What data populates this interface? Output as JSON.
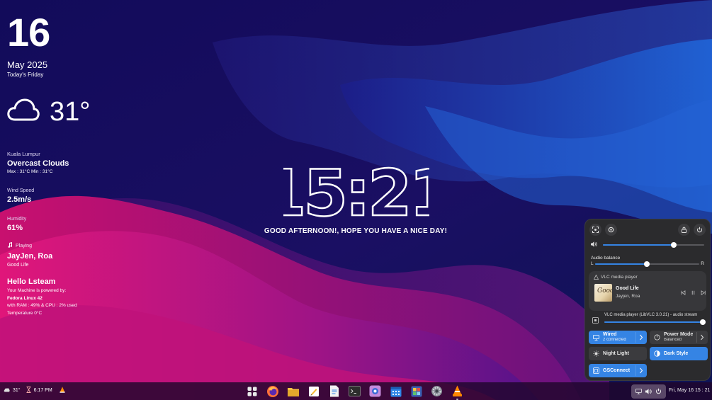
{
  "widget": {
    "day": "16",
    "month_year": "May 2025",
    "today": "Today's Friday",
    "temperature": "31°",
    "city": "Kuala Lumpur",
    "condition": "Overcast Clouds",
    "maxmin": "Max : 31°C    Min : 31°C",
    "wind_label": "Wind Speed",
    "wind_value": "2.5m/s",
    "humidity_label": "Humidity",
    "humidity_value": "61%",
    "playing_label": "Playing",
    "artist": "JayJen, Roa",
    "song": "Good Life",
    "hello": "Hello Lsteam",
    "powered_by": "Your Machine is powered by:",
    "os": "Fedora Linux 42",
    "usage": "with RAM : 49% & CPU : 2% used",
    "temperature_line": "Temperature 0°C"
  },
  "clock": {
    "time": "15:21",
    "greeting": "GOOD AFTERNOON!, HOPE YOU HAVE A NICE DAY!"
  },
  "quick_settings": {
    "volume_level": 0.7,
    "audio_balance_label": "Audio balance",
    "balance_left": "L",
    "balance_right": "R",
    "balance_level": 0.5,
    "media_app": "VLC media player",
    "media_track": "Good Life",
    "media_artist": "Jayjen, Roa",
    "album_mark": "Good",
    "stream_label": "VLC media player (LibVLC 3.0.21) - audio stream",
    "stream_level": 1.0,
    "toggles": {
      "wired": "Wired",
      "wired_sub": "2 connected",
      "power_mode": "Power Mode",
      "power_mode_sub": "Balanced",
      "night_light": "Night Light",
      "dark_style": "Dark Style",
      "gsconnect": "GSConnect"
    }
  },
  "taskbar": {
    "weather_temp": "31°",
    "time_small": "6:17 PM",
    "datetime": "Fri, May 16   15 : 21",
    "apps": [
      "app-grid-icon",
      "firefox-icon",
      "files-icon",
      "text-editor-icon",
      "document-viewer-icon",
      "terminal-icon",
      "image-viewer-icon",
      "calendar-icon",
      "software-icon",
      "settings-icon",
      "vlc-icon"
    ]
  },
  "colors": {
    "accent": "#3584e4",
    "panel": "#2b2b2d",
    "background": "#150a55",
    "wave_pink": "#d6146f"
  }
}
